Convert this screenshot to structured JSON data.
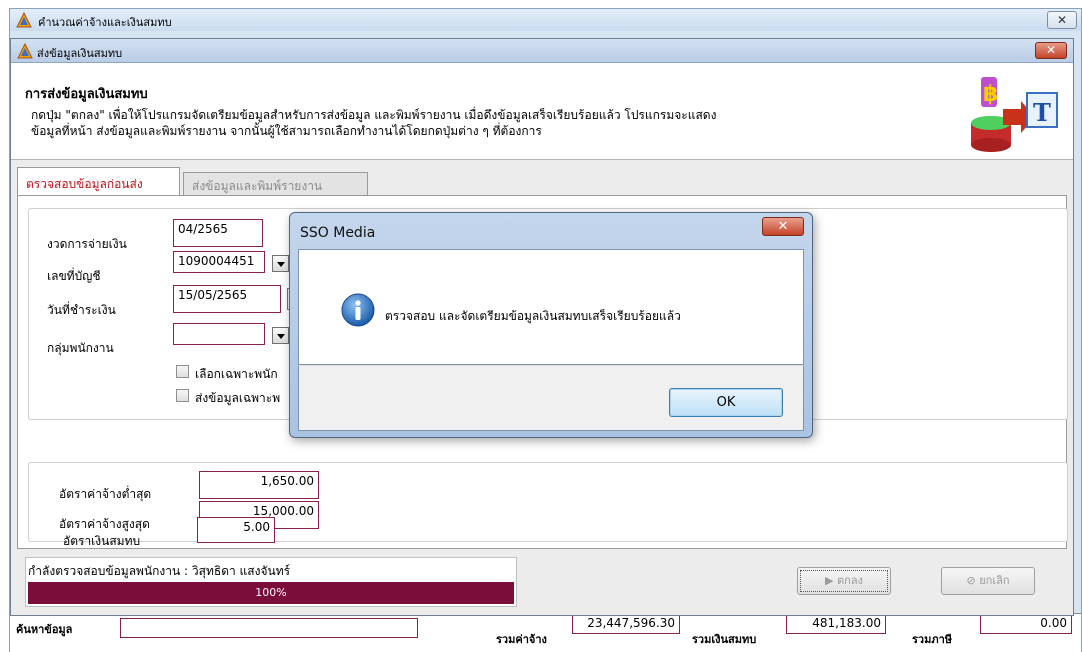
{
  "outer_window": {
    "title": "คำนวณค่าจ้างและเงินสมทบ",
    "close_label": "✕"
  },
  "bottom_bar": {
    "search_label": "ค้นหาข้อมูล",
    "total_wage_label": "รวมค่าจ้าง",
    "total_wage_value": "23,447,596.30",
    "total_contribution_label": "รวมเงินสมทบ",
    "total_contribution_value": "481,183.00",
    "total_tax_label": "รวมภาษี",
    "total_tax_value": "0.00"
  },
  "inner_window": {
    "title": "ส่งข้อมูลเงินสมทบ",
    "close_label": "✕"
  },
  "header": {
    "title": "การส่งข้อมูลเงินสมทบ",
    "line1": "กดปุ่ม \"ตกลง\" เพื่อให้โปรแกรมจัดเตรียมข้อมูลสำหรับการส่งข้อมูล และพิมพ์รายงาน เมื่อดึงข้อมูลเสร็จเรียบร้อยแล้ว โปรแกรมจะแสดง",
    "line2": "ข้อมูลที่หน้า ส่งข้อมูลและพิมพ์รายงาน จากนั้นผู้ใช้สามารถเลือกทำงานได้โดยกดปุ่มต่าง ๆ ที่ต้องการ"
  },
  "tabs": [
    {
      "label": "ตรวจสอบข้อมูลก่อนส่ง",
      "active": true
    },
    {
      "label": "ส่งข้อมูลและพิมพ์รายงาน",
      "active": false
    }
  ],
  "form": {
    "period_label": "งวดการจ่ายเงิน",
    "period_value": "04/2565",
    "account_label": "เลขที่บัญชี",
    "account_value": "1090004451",
    "pay_date_label": "วันที่ชำระเงิน",
    "pay_date_value": "15/05/2565",
    "group_label": "กลุ่มพนักงาน",
    "group_value": "",
    "check1_label": "เลือกเฉพาะพนัก",
    "check2_label": "ส่งข้อมูลเฉพาะพ"
  },
  "rates": {
    "min_wage_label": "อัตราค่าจ้างต่ำสุด",
    "min_wage_value": "1,650.00",
    "max_wage_label": "อัตราค่าจ้างสูงสุด",
    "max_wage_value": "15,000.00",
    "contribution_rate_label": "อัตราเงินสมทบ",
    "contribution_rate_value": "5.00"
  },
  "status": {
    "text": "กำลังตรวจสอบข้อมูลพนักงาน : วิสุทธิดา แสงจันทร์",
    "progress_percent": 100,
    "progress_label": "100%"
  },
  "buttons": {
    "ok_label": "ตกลง",
    "cancel_label": "ยกเลิก"
  },
  "dialog": {
    "title": "SSO Media",
    "message": "ตรวจสอบ และจัดเตรียมข้อมูลเงินสมทบเสร็จเรียบร้อยแล้ว",
    "ok_label": "OK",
    "close_label": "✕"
  },
  "colors": {
    "accent": "#8a1f4b",
    "progress": "#7b0d3a",
    "active_tab": "#c0121a"
  }
}
